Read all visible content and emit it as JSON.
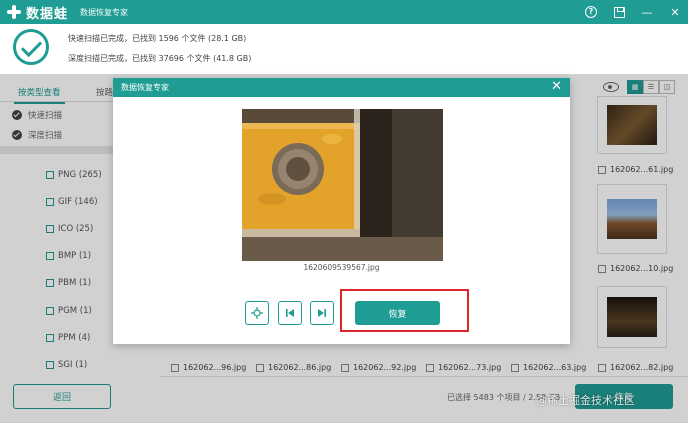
{
  "app": {
    "logo_text": "数据蛙",
    "subtitle": "数据恢复专家",
    "controls": {
      "help": "?",
      "min": "—",
      "close": "✕"
    }
  },
  "status": {
    "quick": "快速扫描已完成，已找到 1596 个文件 (28.1 GB)",
    "deep": "深度扫描已完成，已找到 37696 个文件 (41.8 GB)"
  },
  "left": {
    "tabs": [
      "按类型查看",
      "按路"
    ],
    "scans": [
      "快速扫描",
      "深度扫描"
    ],
    "types": [
      "PNG (265)",
      "GIF (146)",
      "ICO (25)",
      "BMP (1)",
      "PBM (1)",
      "PGM (1)",
      "PPM (4)",
      "SGI (1)"
    ],
    "back": "返回"
  },
  "grid": {
    "labels_right": [
      "162062...61.jpg",
      "162062...10.jpg",
      "162062...82.jpg"
    ],
    "labels_bottom": [
      "162062...96.jpg",
      "162062...86.jpg",
      "162062...92.jpg",
      "162062...73.jpg",
      "162062...63.jpg"
    ]
  },
  "footer": {
    "selected": "已选择 5483 个项目 / 2.58 GB",
    "recover": "恢复"
  },
  "modal": {
    "title": "数据恢复专家",
    "caption": "1620609539567.jpg",
    "recover": "恢复"
  },
  "watermark": "@稀土掘金技术社区",
  "colors": {
    "accent": "#1f9c93",
    "highlight": "#e0262a"
  }
}
